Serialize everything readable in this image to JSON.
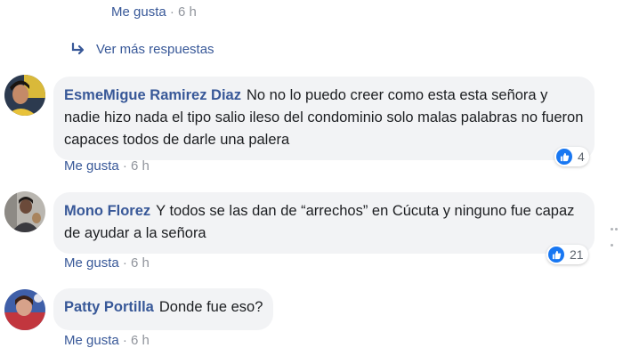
{
  "top_reply": {
    "like": "Me gusta",
    "sep": "·",
    "time": "6 h"
  },
  "more_replies": {
    "label": "Ver más respuestas"
  },
  "comments": [
    {
      "author": "EsmeMigue Ramirez Diaz",
      "text": "No no lo puedo creer como esta esta señora y nadie hizo nada el tipo salio ileso del condominio solo malas palabras no fueron capaces todos de darle una palera",
      "like": "Me gusta",
      "sep": "·",
      "time": "6 h",
      "reactions": "4"
    },
    {
      "author": "Mono Florez",
      "text": "Y todos se las dan de “arrechos” en Cúcuta y ninguno fue capaz de ayudar a la señora",
      "like": "Me gusta",
      "sep": "·",
      "time": "6 h",
      "reactions": "21"
    },
    {
      "author": "Patty Portilla",
      "text": "Donde fue eso?",
      "like": "Me gusta",
      "sep": "·",
      "time": "6 h"
    }
  ],
  "icons": {
    "reply_arrow": "reply-arrow-icon",
    "like": "thumbs-up-icon",
    "options": "more-options-icon"
  },
  "colors": {
    "link": "#385898",
    "bubble": "#f2f3f5",
    "like_badge": "#1877f2",
    "meta": "#90949c"
  }
}
